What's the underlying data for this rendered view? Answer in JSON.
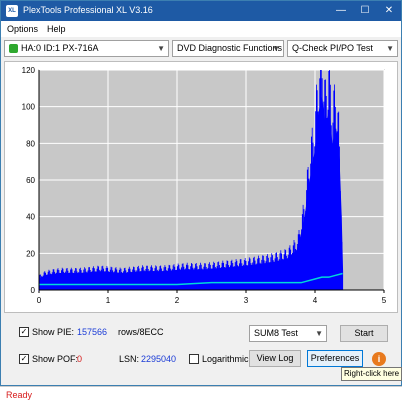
{
  "window": {
    "title": "PlexTools Professional XL V3.16",
    "app_icon": "XL"
  },
  "window_buttons": {
    "minimize": "—",
    "maximize": "☐",
    "close": "✕"
  },
  "menu": {
    "items": [
      "Options",
      "Help"
    ]
  },
  "toolbar": {
    "drive": "HA:0 ID:1  PX-716A",
    "function": "DVD Diagnostic Functions",
    "test": "Q-Check PI/PO Test"
  },
  "colors": {
    "pie_series": "#0000ff",
    "po_line": "#00d8d8",
    "plot_bg": "#c8c8c8",
    "status_red": "#d61a1a",
    "value_blue": "#1a3bd6"
  },
  "chart_data": {
    "type": "area",
    "title": "",
    "xlabel": "",
    "ylabel": "",
    "xlim": [
      0,
      5
    ],
    "ylim": [
      0,
      120
    ],
    "x_ticks": [
      "0",
      "1",
      "2",
      "3",
      "4",
      "5"
    ],
    "y_ticks": [
      "0",
      "20",
      "40",
      "60",
      "80",
      "100",
      "120"
    ],
    "grid": true,
    "series": [
      {
        "values": [
          [
            0.0,
            6
          ],
          [
            0.1,
            8
          ],
          [
            0.3,
            9
          ],
          [
            0.6,
            9
          ],
          [
            0.9,
            10
          ],
          [
            1.2,
            9
          ],
          [
            1.5,
            10
          ],
          [
            1.8,
            10
          ],
          [
            2.1,
            11
          ],
          [
            2.4,
            11
          ],
          [
            2.7,
            12
          ],
          [
            3.0,
            13
          ],
          [
            3.2,
            14
          ],
          [
            3.4,
            15
          ],
          [
            3.6,
            17
          ],
          [
            3.75,
            22
          ],
          [
            3.85,
            38
          ],
          [
            3.92,
            58
          ],
          [
            4.0,
            75
          ],
          [
            4.05,
            95
          ],
          [
            4.1,
            105
          ],
          [
            4.15,
            85
          ],
          [
            4.2,
            98
          ],
          [
            4.25,
            78
          ],
          [
            4.3,
            88
          ],
          [
            4.35,
            70
          ],
          [
            4.38,
            40
          ],
          [
            4.4,
            10
          ]
        ]
      },
      {
        "values": [
          [
            0.0,
            3
          ],
          [
            0.5,
            3
          ],
          [
            1.0,
            3
          ],
          [
            1.5,
            3
          ],
          [
            2.0,
            3
          ],
          [
            2.5,
            4
          ],
          [
            3.0,
            4
          ],
          [
            3.5,
            4
          ],
          [
            3.8,
            4
          ],
          [
            3.9,
            5
          ],
          [
            4.0,
            6
          ],
          [
            4.1,
            7
          ],
          [
            4.2,
            7
          ],
          [
            4.3,
            8
          ],
          [
            4.4,
            9
          ]
        ]
      }
    ]
  },
  "stats": {
    "show_pie_label": "Show PIE:",
    "pie_value": "157566",
    "rows_label": "rows/8ECC",
    "show_pof_label": "Show POF:",
    "pof_value": "0",
    "lsn_label": "LSN:",
    "lsn_value": "2295040",
    "logarithmic_label": "Logarithmic",
    "pie_checked": "✓",
    "pof_checked": "✓"
  },
  "controls": {
    "sum_select": "SUM8 Test",
    "start_button": "Start",
    "viewlog_button": "View Log",
    "preferences_button": "Preferences",
    "info_button": "i"
  },
  "status": {
    "text": "Ready",
    "tooltip": "Right-click here"
  }
}
